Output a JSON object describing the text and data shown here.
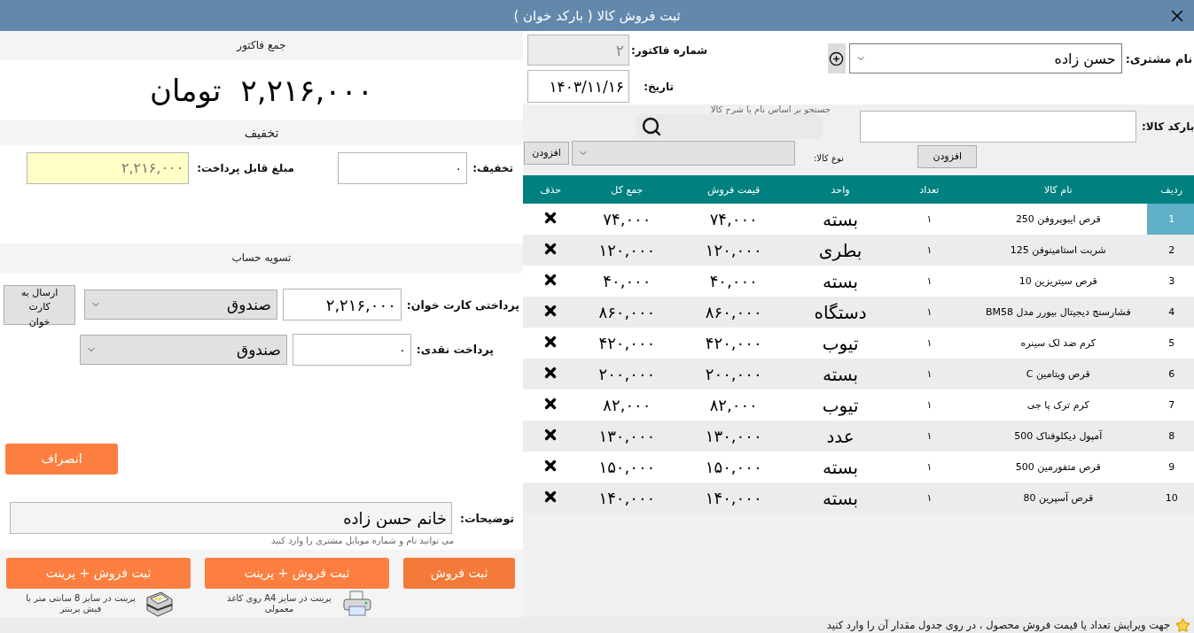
{
  "window": {
    "title": "ثبت فروش کالا ( بارکد خوان )"
  },
  "summary": {
    "header": "جمع فاکتور",
    "total": "۲,۲۱۶,۰۰۰",
    "currency": "تومان"
  },
  "discount": {
    "header": "تخفیف",
    "discount_label": "تخفیف:",
    "discount_value": "۰",
    "payable_label": "مبلغ قابل پرداخت:",
    "payable_value": "۲,۲۱۶,۰۰۰"
  },
  "settlement": {
    "header": "تسویه حساب",
    "card_label": "پرداختی کارت خوان:",
    "card_value": "۲,۲۱۶,۰۰۰",
    "card_account": "صندوق",
    "send_button": "ارسال به کارت خوان",
    "cash_label": "پرداخت نقدی:",
    "cash_value": "۰",
    "cash_account": "صندوق",
    "cancel_button": "انصراف"
  },
  "notes": {
    "label": "توضیحات:",
    "value": "خانم حسن زاده",
    "hint": "می توانید نام و شماره موبایل مشتری را وارد کنید"
  },
  "actions": [
    {
      "label": "ثبت فروش"
    },
    {
      "label": "ثبت فروش + پرینت",
      "caption": "پرینت در سایز A4 روی کاغذ معمولی",
      "kind": "a4"
    },
    {
      "label": "ثبت فروش + پرینت",
      "caption": "پرینت در سایز 8 سانتی متر با فیش پرینتر",
      "kind": "receipt"
    }
  ],
  "header_form": {
    "customer_label": "نام مشتری:",
    "customer": "حسن زاده",
    "invoice_label": "شماره فاکتور:",
    "invoice_number": "۲",
    "date_label": "تاریخ:",
    "date": "۱۴۰۳/۱۱/۱۶"
  },
  "product_entry": {
    "barcode_label": "بارکد کالا:",
    "barcode_add": "افزودن",
    "search_hint": "جستجو بر اساس نام یا شرح کالا",
    "type_label": "نوع کالا:",
    "type_add": "افزودن"
  },
  "table": {
    "columns": [
      "ردیف",
      "نام کالا",
      "تعداد",
      "واحد",
      "قیمت فروش",
      "جمع کل",
      "حذف"
    ],
    "rows": [
      {
        "index": "1",
        "name": "قرص ایبوپروفن 250",
        "qty": "۱",
        "unit": "بسته",
        "price": "۷۴,۰۰۰",
        "total": "۷۴,۰۰۰",
        "selected": true
      },
      {
        "index": "2",
        "name": "شربت استامینوفن 125",
        "qty": "۱",
        "unit": "بطری",
        "price": "۱۲۰,۰۰۰",
        "total": "۱۲۰,۰۰۰",
        "selected": false
      },
      {
        "index": "3",
        "name": "قرص سیتریزین 10",
        "qty": "۱",
        "unit": "بسته",
        "price": "۴۰,۰۰۰",
        "total": "۴۰,۰۰۰",
        "selected": false
      },
      {
        "index": "4",
        "name": "فشارسنج دیجیتال بیورر مدل BM58",
        "qty": "۱",
        "unit": "دستگاه",
        "price": "۸۶۰,۰۰۰",
        "total": "۸۶۰,۰۰۰",
        "selected": false
      },
      {
        "index": "5",
        "name": "کرم ضد لک سینره",
        "qty": "۱",
        "unit": "تیوب",
        "price": "۴۲۰,۰۰۰",
        "total": "۴۲۰,۰۰۰",
        "selected": false
      },
      {
        "index": "6",
        "name": "قرص ویتامین C",
        "qty": "۱",
        "unit": "بسته",
        "price": "۲۰۰,۰۰۰",
        "total": "۲۰۰,۰۰۰",
        "selected": false
      },
      {
        "index": "7",
        "name": "کرم ترک پا جی",
        "qty": "۱",
        "unit": "تیوب",
        "price": "۸۲,۰۰۰",
        "total": "۸۲,۰۰۰",
        "selected": false
      },
      {
        "index": "8",
        "name": "آمپول دیکلوفناک 500",
        "qty": "۱",
        "unit": "عدد",
        "price": "۱۳۰,۰۰۰",
        "total": "۱۳۰,۰۰۰",
        "selected": false
      },
      {
        "index": "9",
        "name": "قرص متفورمین 500",
        "qty": "۱",
        "unit": "بسته",
        "price": "۱۵۰,۰۰۰",
        "total": "۱۵۰,۰۰۰",
        "selected": false
      },
      {
        "index": "10",
        "name": "قرص آسپرین 80",
        "qty": "۱",
        "unit": "بسته",
        "price": "۱۴۰,۰۰۰",
        "total": "۱۴۰,۰۰۰",
        "selected": false
      }
    ]
  },
  "status_bar": {
    "text": "جهت ویرایش تعداد یا قیمت فروش محصول ، در روی جدول مقدار آن را وارد کنید"
  }
}
